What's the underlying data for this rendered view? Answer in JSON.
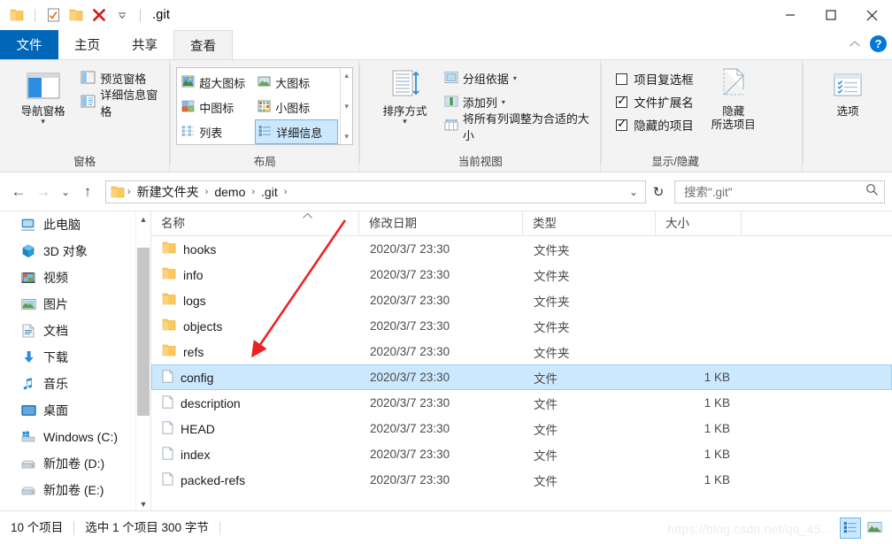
{
  "window": {
    "title": ".git",
    "quick_access": [
      {
        "name": "folder-icon",
        "label": "文件夹"
      },
      {
        "name": "properties-icon",
        "label": "属性"
      },
      {
        "name": "new-folder-icon",
        "label": "新建文件夹"
      },
      {
        "name": "delete-icon",
        "label": "删除"
      },
      {
        "name": "customize-caret-icon",
        "label": "自定义快速访问工具栏"
      }
    ],
    "controls": {
      "minimize": "—",
      "maximize": "☐",
      "close": "✕"
    }
  },
  "tabs": [
    {
      "label": "文件",
      "type": "file"
    },
    {
      "label": "主页",
      "type": "normal"
    },
    {
      "label": "共享",
      "type": "normal"
    },
    {
      "label": "查看",
      "type": "active"
    }
  ],
  "ribbon_controls": {
    "collapse": "⌃",
    "help": "?"
  },
  "ribbon": {
    "groups": [
      {
        "label": "窗格",
        "big_button": {
          "label": "导航窗格",
          "icon": "nav-pane-icon",
          "has_caret": true
        },
        "items": [
          {
            "label": "预览窗格",
            "icon": "preview-pane-icon"
          },
          {
            "label": "详细信息窗格",
            "icon": "details-pane-icon"
          }
        ]
      },
      {
        "label": "布局",
        "gallery": [
          {
            "label": "超大图标",
            "icon": "extra-large-icons-icon",
            "selected": false
          },
          {
            "label": "大图标",
            "icon": "large-icons-icon",
            "selected": false
          },
          {
            "label": "中图标",
            "icon": "medium-icons-icon",
            "selected": false
          },
          {
            "label": "小图标",
            "icon": "small-icons-icon",
            "selected": false
          },
          {
            "label": "列表",
            "icon": "list-view-icon",
            "selected": false
          },
          {
            "label": "详细信息",
            "icon": "details-view-icon",
            "selected": true
          }
        ]
      },
      {
        "label": "当前视图",
        "big_button": {
          "label": "排序方式",
          "icon": "sort-by-icon",
          "has_caret": true
        },
        "items": [
          {
            "label": "分组依据",
            "icon": "group-by-icon",
            "has_caret": true
          },
          {
            "label": "添加列",
            "icon": "add-column-icon",
            "has_caret": true
          },
          {
            "label": "将所有列调整为合适的大小",
            "icon": "size-columns-icon",
            "has_caret": false
          }
        ]
      },
      {
        "label": "显示/隐藏",
        "checkboxes": [
          {
            "label": "项目复选框",
            "checked": false
          },
          {
            "label": "文件扩展名",
            "checked": true
          },
          {
            "label": "隐藏的项目",
            "checked": true
          }
        ],
        "big_button": {
          "label_line1": "隐藏",
          "label_line2": "所选项目",
          "icon": "hide-selected-items-icon"
        }
      },
      {
        "label": "",
        "options_button": {
          "label": "选项",
          "icon": "options-icon"
        }
      }
    ]
  },
  "addressbar": {
    "back": {
      "name": "back-arrow-icon",
      "glyph": "←",
      "enabled": true
    },
    "forward": {
      "name": "forward-arrow-icon",
      "glyph": "→",
      "enabled": false
    },
    "recent": {
      "name": "recent-locations-icon",
      "glyph": "⌄"
    },
    "up": {
      "name": "up-arrow-icon",
      "glyph": "↑"
    },
    "breadcrumbs": [
      "新建文件夹",
      "demo",
      ".git"
    ],
    "dropdown": {
      "name": "address-dropdown-icon",
      "glyph": "⌄"
    },
    "refresh": {
      "name": "refresh-icon",
      "glyph": "↻"
    },
    "search": {
      "placeholder": "搜索\".git\"",
      "value": "",
      "icon": "search-icon"
    }
  },
  "sidebar": {
    "items": [
      {
        "label": "此电脑",
        "icon": "this-pc-icon"
      },
      {
        "label": "3D 对象",
        "icon": "3d-objects-icon"
      },
      {
        "label": "视频",
        "icon": "videos-icon"
      },
      {
        "label": "图片",
        "icon": "pictures-icon"
      },
      {
        "label": "文档",
        "icon": "documents-icon"
      },
      {
        "label": "下载",
        "icon": "downloads-icon"
      },
      {
        "label": "音乐",
        "icon": "music-icon"
      },
      {
        "label": "桌面",
        "icon": "desktop-icon"
      },
      {
        "label": "Windows (C:)",
        "icon": "windows-drive-icon"
      },
      {
        "label": "新加卷 (D:)",
        "icon": "drive-icon"
      },
      {
        "label": "新加卷 (E:)",
        "icon": "drive-icon"
      }
    ]
  },
  "filelist": {
    "columns": [
      "名称",
      "修改日期",
      "类型",
      "大小"
    ],
    "sort_indicator": "^",
    "rows": [
      {
        "name": "hooks",
        "date": "2020/3/7 23:30",
        "type": "文件夹",
        "size": "",
        "kind": "folder",
        "selected": false
      },
      {
        "name": "info",
        "date": "2020/3/7 23:30",
        "type": "文件夹",
        "size": "",
        "kind": "folder",
        "selected": false
      },
      {
        "name": "logs",
        "date": "2020/3/7 23:30",
        "type": "文件夹",
        "size": "",
        "kind": "folder",
        "selected": false
      },
      {
        "name": "objects",
        "date": "2020/3/7 23:30",
        "type": "文件夹",
        "size": "",
        "kind": "folder",
        "selected": false
      },
      {
        "name": "refs",
        "date": "2020/3/7 23:30",
        "type": "文件夹",
        "size": "",
        "kind": "folder",
        "selected": false
      },
      {
        "name": "config",
        "date": "2020/3/7 23:30",
        "type": "文件",
        "size": "1 KB",
        "kind": "file",
        "selected": true
      },
      {
        "name": "description",
        "date": "2020/3/7 23:30",
        "type": "文件",
        "size": "1 KB",
        "kind": "file",
        "selected": false
      },
      {
        "name": "HEAD",
        "date": "2020/3/7 23:30",
        "type": "文件",
        "size": "1 KB",
        "kind": "file",
        "selected": false
      },
      {
        "name": "index",
        "date": "2020/3/7 23:30",
        "type": "文件",
        "size": "1 KB",
        "kind": "file",
        "selected": false
      },
      {
        "name": "packed-refs",
        "date": "2020/3/7 23:30",
        "type": "文件",
        "size": "1 KB",
        "kind": "file",
        "selected": false
      }
    ]
  },
  "statusbar": {
    "item_count": "10 个项目",
    "selection": "选中 1 个项目  300 字节",
    "view_buttons": [
      {
        "name": "details-view-button",
        "active": true
      },
      {
        "name": "large-icons-view-button",
        "active": false
      }
    ]
  },
  "watermark": "https://blog.csdn.net/qq_45...",
  "annotation": {
    "type": "arrow",
    "color": "#ee2222",
    "points_to": "config"
  },
  "colors": {
    "accent": "#0067b8",
    "selection_fill": "#cce8ff",
    "selection_border": "#9fd1f7",
    "ribbon_bg": "#f3f3f3",
    "folder_yellow": "#fdc85b",
    "annotation_red": "#ee2222"
  }
}
